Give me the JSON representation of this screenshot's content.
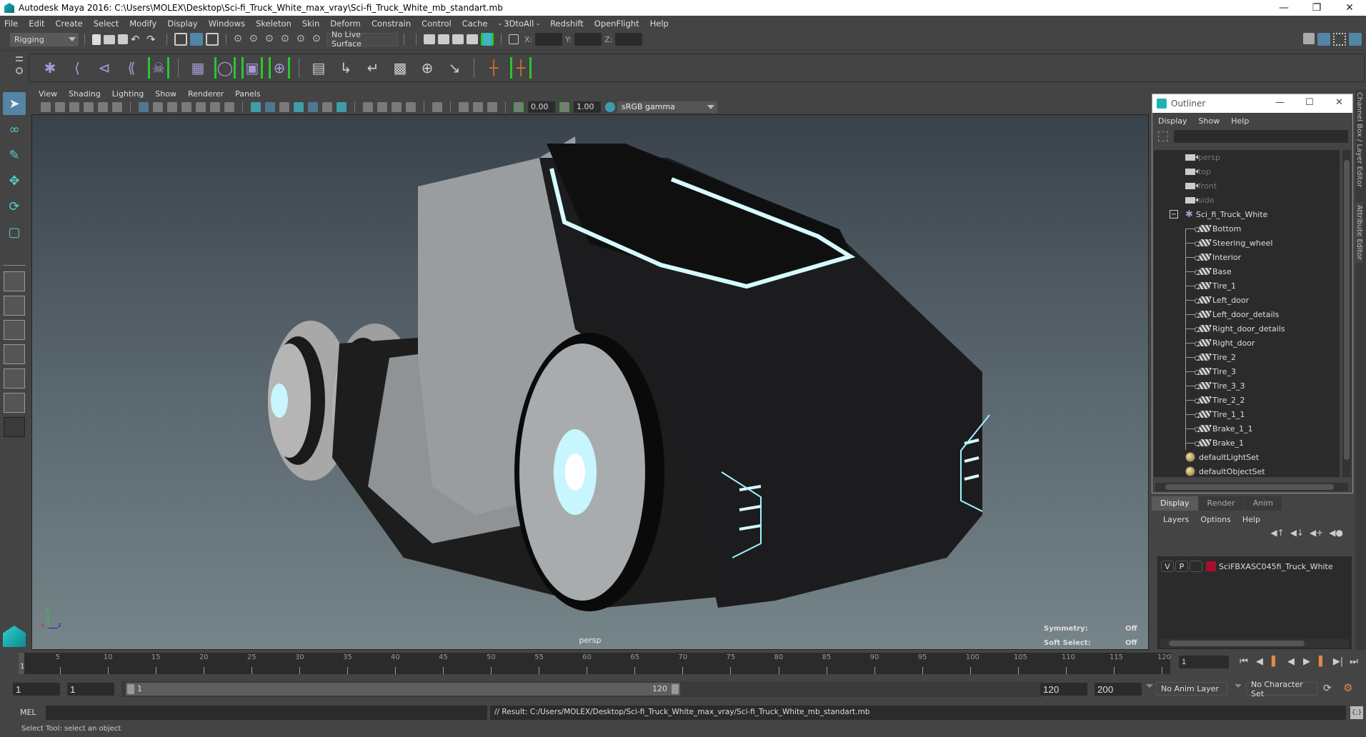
{
  "app": {
    "title": "Autodesk Maya 2016: C:\\Users\\MOLEX\\Desktop\\Sci-fi_Truck_White_max_vray\\Sci-fi_Truck_White_mb_standart.mb",
    "window_buttons": [
      "minimize",
      "restore",
      "close"
    ]
  },
  "menubar": [
    "File",
    "Edit",
    "Create",
    "Select",
    "Modify",
    "Display",
    "Windows",
    "Skeleton",
    "Skin",
    "Deform",
    "Constrain",
    "Control",
    "Cache",
    "- 3DtoAll -",
    "Redshift",
    "OpenFlight",
    "Help"
  ],
  "status_line": {
    "menu_set": "Rigging",
    "live_surface": "No Live Surface",
    "x_label": "X:",
    "y_label": "Y:",
    "z_label": "Z:",
    "x_value": "",
    "y_value": "",
    "z_value": ""
  },
  "shelf_icons": [
    "joint-tool",
    "ik-handle",
    "ik-spline",
    "insert-joint",
    "quick-rig",
    "paint-skin-weights",
    "smooth-bind",
    "interactive-bind",
    "bind-pose",
    "parent-constraint",
    "point-constraint",
    "orient-constraint",
    "scale-constraint",
    "aim-constraint",
    "pole-vector-constraint",
    "mirror-joint",
    "connect-joint"
  ],
  "toolbox": [
    "select-tool",
    "lasso-tool",
    "paint-select-tool",
    "move-tool",
    "rotate-tool",
    "scale-tool"
  ],
  "viewport": {
    "menus": [
      "View",
      "Shading",
      "Lighting",
      "Show",
      "Renderer",
      "Panels"
    ],
    "exposure": "0.00",
    "gamma": "1.00",
    "color_space": "sRGB gamma",
    "camera_label": "persp",
    "hud": {
      "symmetry_label": "Symmetry:",
      "symmetry_value": "Off",
      "soft_select_label": "Soft Select:",
      "soft_select_value": "Off"
    },
    "axis": {
      "x": "x",
      "y": "y",
      "z": "z"
    }
  },
  "outliner": {
    "title": "Outliner",
    "menus": [
      "Display",
      "Show",
      "Help"
    ],
    "search_value": "",
    "cameras": [
      "persp",
      "top",
      "front",
      "side"
    ],
    "group": "Sci_fi_Truck_White",
    "children": [
      "Bottom",
      "Steering_wheel",
      "Interior",
      "Base",
      "Tire_1",
      "Left_door",
      "Left_door_details",
      "Right_door_details",
      "Right_door",
      "Tire_2",
      "Tire_3",
      "Tire_3_3",
      "Tire_2_2",
      "Tire_1_1",
      "Brake_1_1",
      "Brake_1"
    ],
    "sets": [
      "defaultLightSet",
      "defaultObjectSet"
    ]
  },
  "side_tabs": [
    "Channel Box / Layer Editor",
    "Attribute Editor"
  ],
  "layer_editor": {
    "tabs": [
      "Display",
      "Render",
      "Anim"
    ],
    "active_tab": "Display",
    "menus": [
      "Layers",
      "Options",
      "Help"
    ],
    "layers": [
      {
        "v": "V",
        "p": "P",
        "color": "#a5102f",
        "name": "SciFBXASC045fi_Truck_White"
      }
    ]
  },
  "timeline": {
    "ticks": [
      "5",
      "10",
      "15",
      "20",
      "25",
      "30",
      "35",
      "40",
      "45",
      "50",
      "55",
      "60",
      "65",
      "70",
      "75",
      "80",
      "85",
      "90",
      "95",
      "100",
      "105",
      "110",
      "115",
      "120"
    ],
    "current_frame_marker": "1",
    "current_frame": "1"
  },
  "range": {
    "start": "1",
    "playback_start": "1",
    "slider_start": "1",
    "slider_end": "120",
    "playback_end": "120",
    "end": "200",
    "anim_layer": "No Anim Layer",
    "character_set": "No Character Set"
  },
  "command_line": {
    "language": "MEL",
    "input": "",
    "result": "// Result: C:/Users/MOLEX/Desktop/Sci-fi_Truck_White_max_vray/Sci-fi_Truck_White_mb_standart.mb"
  },
  "status": "Select Tool: select an object",
  "colors": {
    "accent": "#5285a6",
    "shelf_bracket": "#2ec42e",
    "viewport_bottom": "#76858a",
    "glow": "#bff6ff"
  }
}
